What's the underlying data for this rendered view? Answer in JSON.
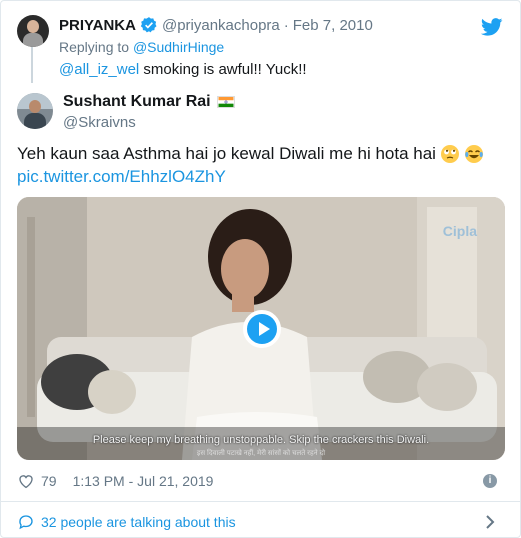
{
  "parent_tweet": {
    "name": "PRIYANKA",
    "handle": "@priyankachopra",
    "separator": "·",
    "date": "Feb 7, 2010",
    "replying_prefix": "Replying to ",
    "replying_to": "@SudhirHinge",
    "mention": "@all_iz_wel",
    "text": " smoking is awful!! Yuck!!"
  },
  "tweet": {
    "name": "Sushant Kumar Rai",
    "handle": "@Skraivns",
    "text": "Yeh kaun saa Asthma hai jo kewal Diwali me hi hota hai",
    "link": "pic.twitter.com/EhhzlO4ZhY",
    "emojis": [
      "rolling-eyes-emoji",
      "laughing-crying-emoji"
    ]
  },
  "video": {
    "brand": "Cipla",
    "subtitle": "Please keep my breathing unstoppable. Skip the crackers this Diwali.",
    "subtitle_secondary": "इस दिवाली पटाखे नहीं, मेरी सांसों को चलते रहने दो"
  },
  "footer": {
    "likes": "79",
    "timestamp": "1:13 PM - Jul 21, 2019",
    "info": "i",
    "talking": "32 people are talking about this"
  },
  "colors": {
    "link": "#1b95e0",
    "muted": "#657786",
    "twitter_blue": "#1da1f2"
  }
}
